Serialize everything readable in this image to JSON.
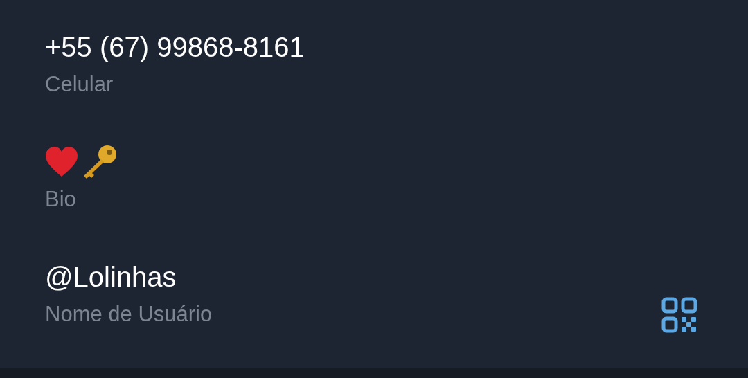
{
  "fields": [
    {
      "kind": "text",
      "value": "+55 (67) 99868-8161",
      "label": "Celular"
    },
    {
      "kind": "emoji",
      "label": "Bio"
    },
    {
      "kind": "username",
      "value": "@Lolinhas",
      "label": "Nome de Usuário"
    }
  ]
}
